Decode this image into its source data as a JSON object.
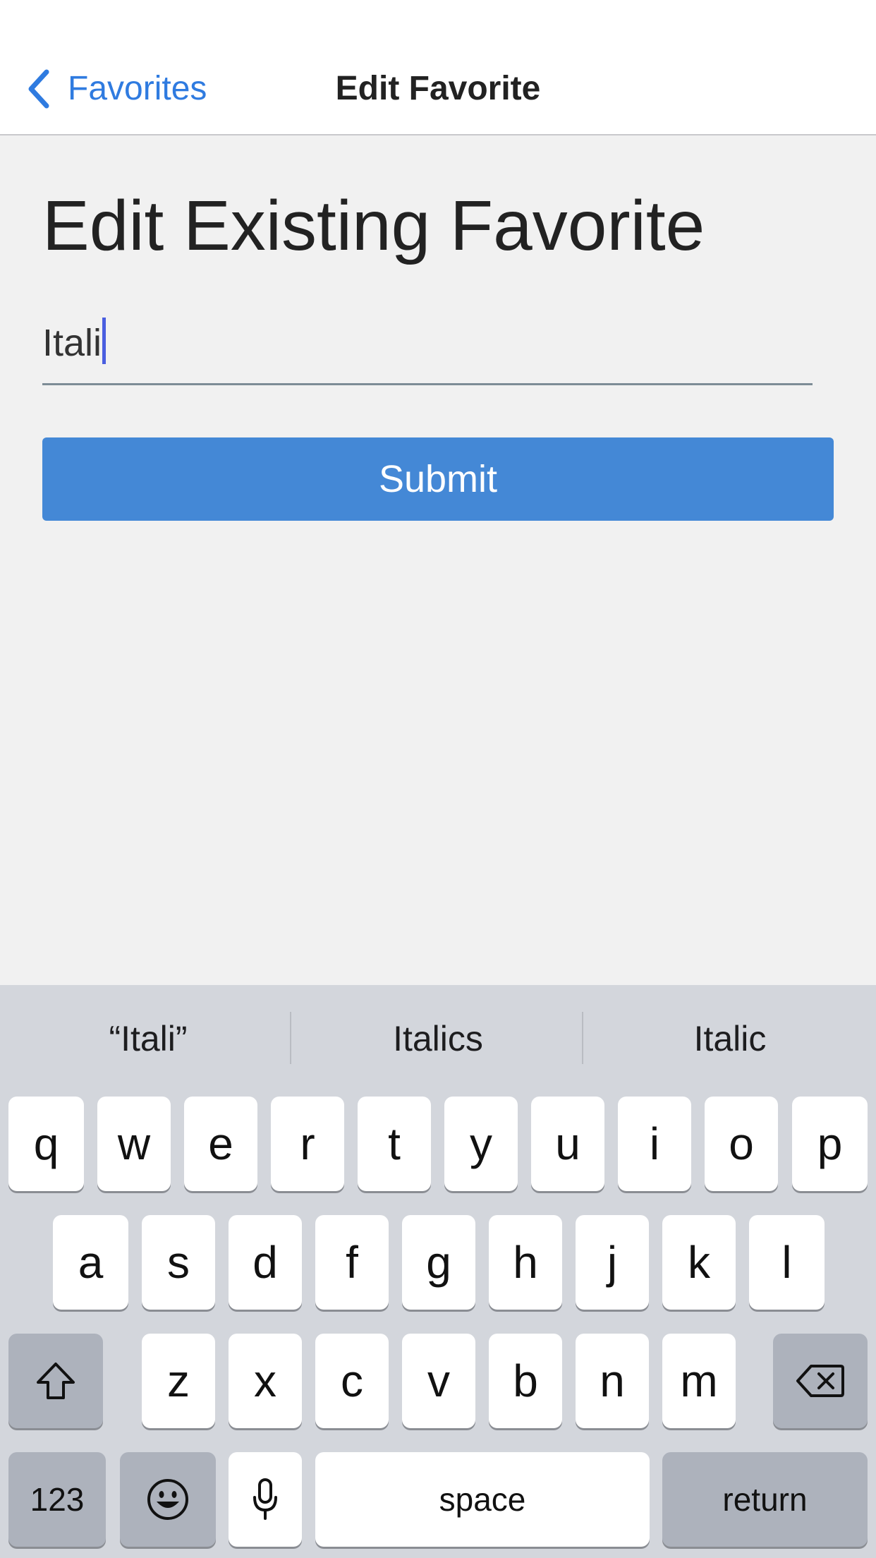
{
  "nav": {
    "back_label": "Favorites",
    "title": "Edit Favorite"
  },
  "main": {
    "heading": "Edit Existing Favorite",
    "field_value": "Itali",
    "submit_label": "Submit"
  },
  "keyboard": {
    "suggestions": [
      "“Itali”",
      "Italics",
      "Italic"
    ],
    "row1": [
      "q",
      "w",
      "e",
      "r",
      "t",
      "y",
      "u",
      "i",
      "o",
      "p"
    ],
    "row2": [
      "a",
      "s",
      "d",
      "f",
      "g",
      "h",
      "j",
      "k",
      "l"
    ],
    "row3": [
      "z",
      "x",
      "c",
      "v",
      "b",
      "n",
      "m"
    ],
    "numbers_label": "123",
    "space_label": "space",
    "return_label": "return",
    "icons": {
      "back": "chevron-left-icon",
      "shift": "shift-arrow-icon",
      "delete": "backspace-icon",
      "emoji": "emoji-face-icon",
      "dictation": "microphone-icon"
    }
  },
  "colors": {
    "accent": "#2f7be0",
    "button": "#4488d6",
    "caret": "#4a5ee0",
    "background": "#f1f1f1",
    "keyboard_bg": "#d3d6dc"
  }
}
